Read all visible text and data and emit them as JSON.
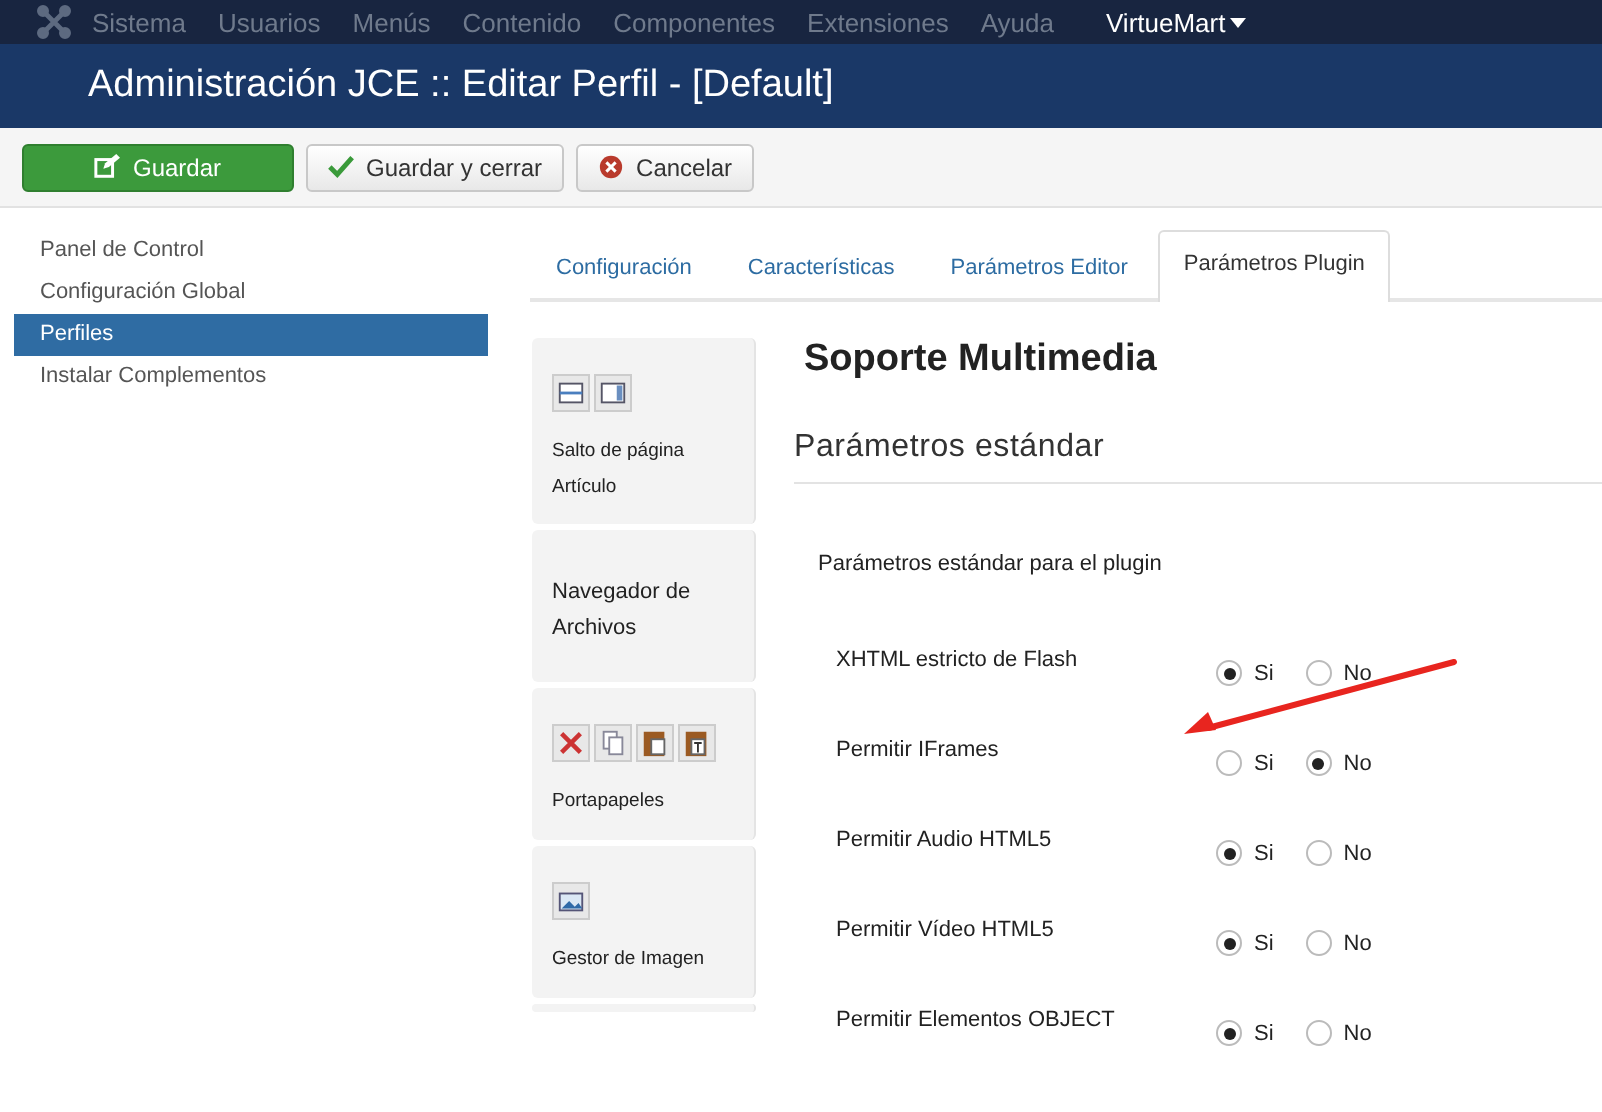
{
  "menu_bar": {
    "items": [
      "Sistema",
      "Usuarios",
      "Menús",
      "Contenido",
      "Componentes",
      "Extensiones",
      "Ayuda"
    ],
    "user_menu": "VirtueMart"
  },
  "header": {
    "title": "Administración JCE :: Editar Perfil - [Default]"
  },
  "toolbar": {
    "buttons": [
      {
        "label": "Guardar",
        "kind": "save"
      },
      {
        "label": "Guardar y cerrar",
        "kind": "check"
      },
      {
        "label": "Cancelar",
        "kind": "cancel"
      }
    ]
  },
  "sidebar": {
    "items": [
      {
        "label": "Panel de Control",
        "selected": false
      },
      {
        "label": "Configuración Global",
        "selected": false
      },
      {
        "label": "Perfiles",
        "selected": true
      },
      {
        "label": "Instalar Complementos",
        "selected": false
      }
    ]
  },
  "tabs": [
    {
      "label": "Configuración",
      "selected": false
    },
    {
      "label": "Características",
      "selected": false
    },
    {
      "label": "Parámetros Editor",
      "selected": false
    },
    {
      "label": "Parámetros Plugin",
      "selected": true
    }
  ],
  "plugins": [
    {
      "labels": [
        "Salto de página",
        "Artículo"
      ],
      "icons": [
        {
          "kind": "pagebreak"
        },
        {
          "kind": "article"
        }
      ]
    },
    {
      "labels": [
        "Navegador de Archivos"
      ]
    },
    {
      "labels": [
        "Portapapeles"
      ],
      "icons": [
        {
          "kind": "cut"
        },
        {
          "kind": "copy"
        },
        {
          "kind": "paste"
        },
        {
          "kind": "pastetext"
        }
      ]
    },
    {
      "labels": [
        "Gestor de Imagen"
      ],
      "icons": [
        {
          "kind": "image"
        }
      ]
    }
  ],
  "content": {
    "title": "Soporte Multimedia",
    "section": "Parámetros estándar",
    "subsection": "Parámetros estándar para el plugin",
    "rows": [
      {
        "label": "XHTML estricto de Flash",
        "options": [
          {
            "label": "Si",
            "selected": true
          },
          {
            "label": "No",
            "selected": false
          }
        ]
      },
      {
        "label": "Permitir IFrames",
        "options": [
          {
            "label": "Si",
            "selected": false
          },
          {
            "label": "No",
            "selected": true
          }
        ]
      },
      {
        "label": "Permitir Audio HTML5",
        "options": [
          {
            "label": "Si",
            "selected": true
          },
          {
            "label": "No",
            "selected": false
          }
        ]
      },
      {
        "label": "Permitir Vídeo HTML5",
        "options": [
          {
            "label": "Si",
            "selected": true
          },
          {
            "label": "No",
            "selected": false
          }
        ]
      },
      {
        "label": "Permitir Elementos OBJECT",
        "options": [
          {
            "label": "Si",
            "selected": true
          },
          {
            "label": "No",
            "selected": false
          }
        ]
      }
    ]
  }
}
